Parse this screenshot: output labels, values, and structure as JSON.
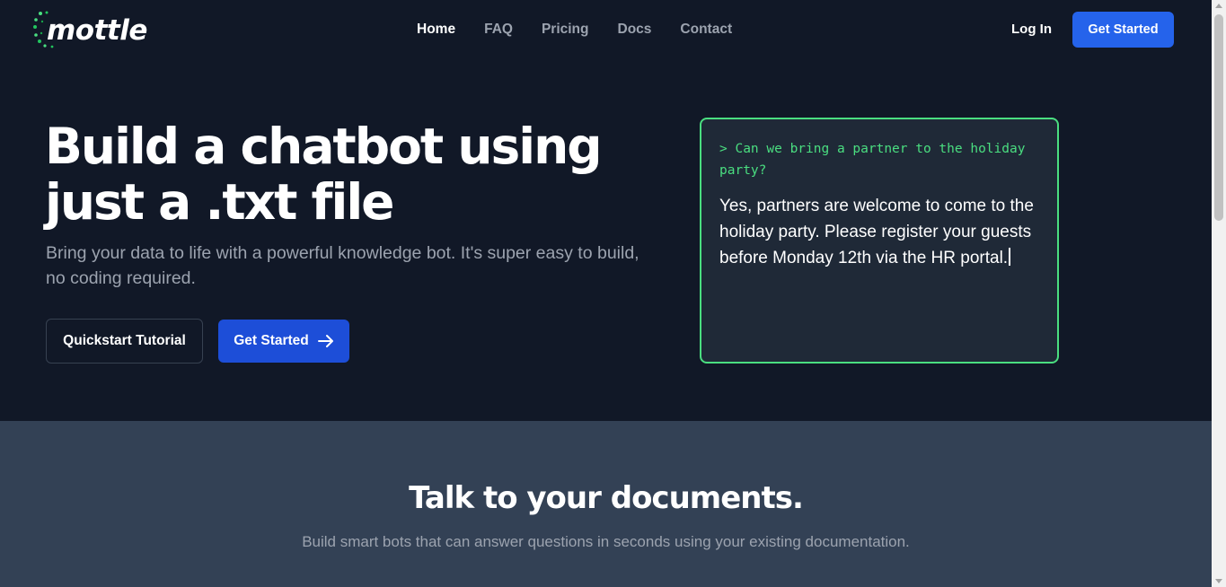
{
  "brand": {
    "logo_text": "mottle"
  },
  "nav": {
    "links": [
      {
        "label": "Home",
        "active": true
      },
      {
        "label": "FAQ",
        "active": false
      },
      {
        "label": "Pricing",
        "active": false
      },
      {
        "label": "Docs",
        "active": false
      },
      {
        "label": "Contact",
        "active": false
      }
    ],
    "login_label": "Log In",
    "get_started_label": "Get Started"
  },
  "hero": {
    "title_line1": "Build a chatbot using",
    "title_line2": "just a .txt file",
    "subtitle": "Bring your data to life with a powerful knowledge bot. It's super easy to build, no coding required.",
    "quickstart_label": "Quickstart Tutorial",
    "get_started_label": "Get Started",
    "arrow_icon": "arrow-right-icon"
  },
  "terminal": {
    "prompt": "> Can we bring a partner to the holiday party?",
    "answer": "Yes, partners are welcome to come to the holiday party. Please register your guests before Monday 12th via the HR portal."
  },
  "section2": {
    "title": "Talk to your documents.",
    "subtitle": "Build smart bots that can answer questions in seconds using your existing documentation."
  },
  "colors": {
    "background": "#111827",
    "accent_blue": "#2563eb",
    "accent_green": "#4ade80",
    "section_bg": "#334155"
  }
}
